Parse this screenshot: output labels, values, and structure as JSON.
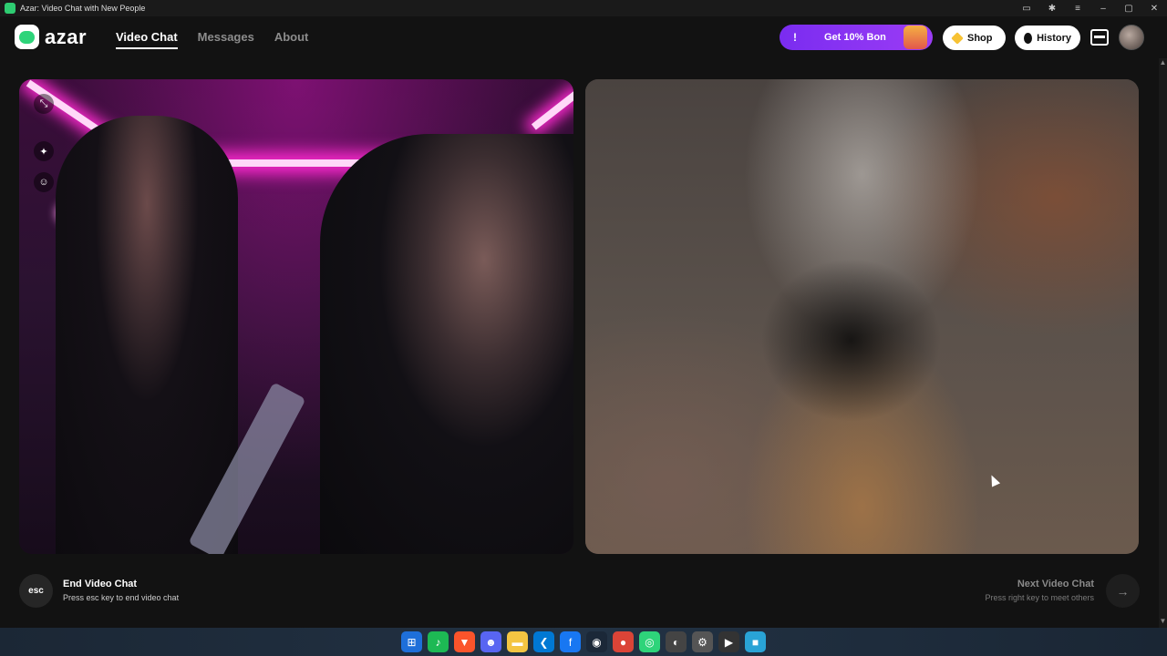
{
  "window": {
    "title": "Azar: Video Chat with New People"
  },
  "header": {
    "logo_text": "azar",
    "nav": [
      {
        "label": "Video Chat",
        "active": true
      },
      {
        "label": "Messages",
        "active": false
      },
      {
        "label": "About",
        "active": false
      }
    ],
    "promo": {
      "mark": "!",
      "label": "Get 10% Bon"
    },
    "shop_label": "Shop",
    "history_label": "History"
  },
  "footer": {
    "esc_key": "esc",
    "end_title": "End Video Chat",
    "end_sub": "Press esc key to end video chat",
    "next_title": "Next Video Chat",
    "next_sub": "Press right key to meet others",
    "next_arrow": "→"
  },
  "colors": {
    "accent": "#2ed47a",
    "promo": "#8a35f2",
    "background": "#121212"
  },
  "taskbar_icons": [
    "windows-icon",
    "spotify-icon",
    "brave-icon",
    "discord-icon",
    "files-icon",
    "vscode-icon",
    "facebook-icon",
    "steam-icon",
    "chrome-icon",
    "azar-icon",
    "app-icon",
    "settings-icon",
    "media-icon",
    "app2-icon"
  ]
}
